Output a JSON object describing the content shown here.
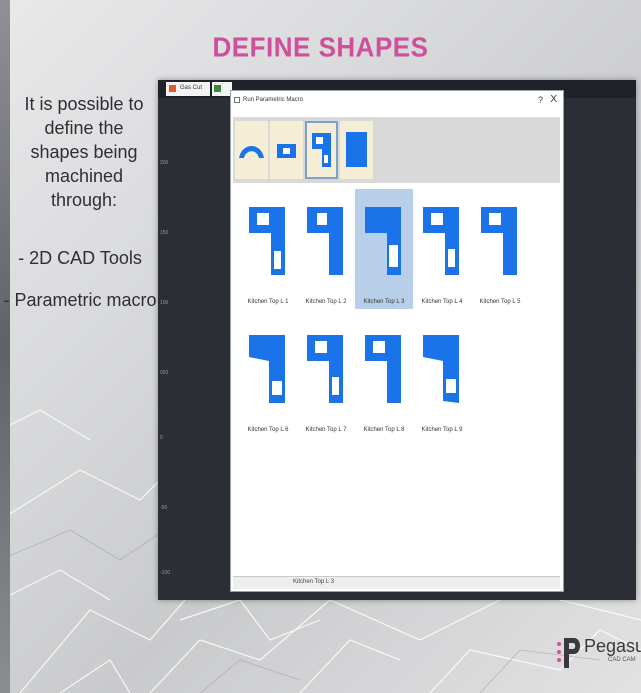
{
  "slide": {
    "title": "DEFINE SHAPES",
    "intro": "It is possible to define the shapes being machined through:",
    "bullets": [
      "- 2D CAD Tools",
      "- Parametric macro"
    ]
  },
  "app": {
    "tabs": [
      "Gas Cut",
      ""
    ],
    "ruler": [
      "200",
      "150",
      "100",
      "050",
      "0",
      "-50",
      "-100"
    ]
  },
  "dialog": {
    "title": "Run Parametric Macro",
    "help": "?",
    "close": "X",
    "toolbar": [
      {
        "icon": "arch-icon"
      },
      {
        "icon": "rectangle-with-cutout-icon"
      },
      {
        "icon": "l-shape-icon",
        "selected": true
      },
      {
        "icon": "filled-rectangle-icon"
      }
    ],
    "items": [
      {
        "label": "Kitchen Top L 1"
      },
      {
        "label": "Kitchen Top L 2"
      },
      {
        "label": "Kitchen Top L 3",
        "selected": true
      },
      {
        "label": "Kitchen Top L 4"
      },
      {
        "label": "Kitchen Top L 5"
      },
      {
        "label": "Kitchen Top L 6"
      },
      {
        "label": "Kitchen Top L 7"
      },
      {
        "label": "Kitchen Top L 8"
      },
      {
        "label": "Kitchen Top L 9"
      }
    ],
    "status": "Kitchen Top L 3"
  },
  "logo": {
    "name": "Pegasus",
    "sub": "CAD CAM"
  },
  "colors": {
    "title": "#cf4f9a",
    "shape": "#1a73e8",
    "selection": "#b7cfe8",
    "toolbar_bg": "#f6edd6"
  }
}
